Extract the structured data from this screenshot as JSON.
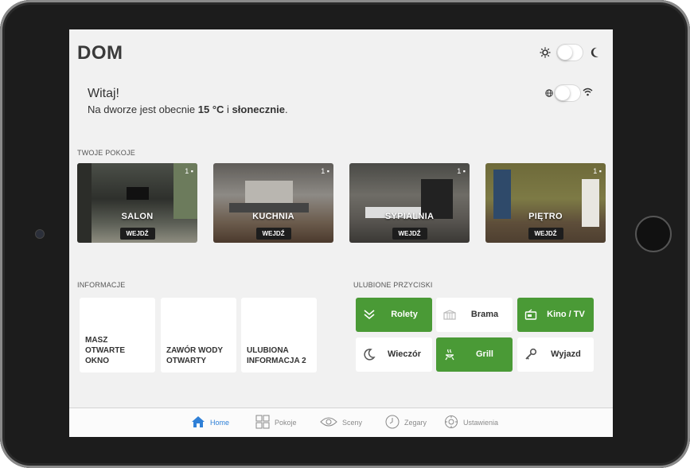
{
  "header": {
    "title": "DOM"
  },
  "toggles": {
    "theme": {
      "left_icon": "sun-icon",
      "right_icon": "moon-icon"
    },
    "network": {
      "left_icon": "globe-icon",
      "right_icon": "wifi-icon"
    }
  },
  "welcome": {
    "greeting": "Witaj!",
    "weather_prefix": "Na dworze jest obecnie ",
    "temperature": "15 °C",
    "weather_mid": " i ",
    "condition": "słonecznie",
    "weather_suffix": "."
  },
  "rooms": {
    "label": "TWOJE POKOJE",
    "enter_label": "WEJDŹ",
    "items": [
      {
        "name": "SALON",
        "count": "1"
      },
      {
        "name": "KUCHNIA",
        "count": "1"
      },
      {
        "name": "SYPIALNIA",
        "count": "1"
      },
      {
        "name": "PIĘTRO",
        "count": "1"
      }
    ]
  },
  "info": {
    "label": "INFORMACJE",
    "items": [
      {
        "text": "MASZ\nOTWARTE\nOKNO"
      },
      {
        "text": "ZAWÓR WODY\nOTWARTY"
      },
      {
        "text": "ULUBIONA\nINFORMACJA 2"
      }
    ]
  },
  "favorites": {
    "label": "ULUBIONE PRZYCISKI",
    "items": [
      {
        "label": "Rolety",
        "icon": "blinds-icon",
        "active": true
      },
      {
        "label": "Brama",
        "icon": "gate-icon",
        "active": false
      },
      {
        "label": "Kino / TV",
        "icon": "tv-icon",
        "active": true
      },
      {
        "label": "Wieczór",
        "icon": "moon-icon",
        "active": false
      },
      {
        "label": "Grill",
        "icon": "grill-icon",
        "active": true
      },
      {
        "label": "Wyjazd",
        "icon": "key-icon",
        "active": false
      }
    ]
  },
  "tabbar": {
    "active": "Home",
    "items": [
      {
        "label": "Home",
        "icon": "home-icon"
      },
      {
        "label": "Pokoje",
        "icon": "grid-icon"
      },
      {
        "label": "Sceny",
        "icon": "eye-icon"
      },
      {
        "label": "Zegary",
        "icon": "clock-icon"
      },
      {
        "label": "Ustawienia",
        "icon": "settings-icon"
      }
    ]
  },
  "colors": {
    "accent_green": "#4a9a36",
    "tab_active": "#2f80d7",
    "background": "#f1f1f1"
  }
}
